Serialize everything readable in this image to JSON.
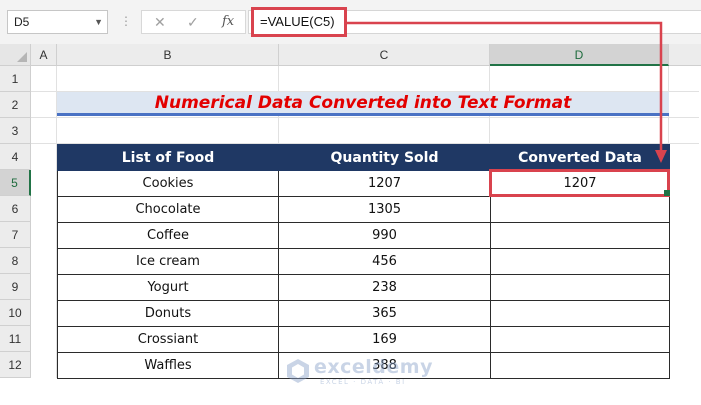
{
  "formula_bar": {
    "name_box": "D5",
    "formula": "=VALUE(C5)",
    "cancel_icon": "✕",
    "enter_icon": "✓",
    "fx_icon": "fx"
  },
  "columns": [
    "A",
    "B",
    "C",
    "D"
  ],
  "rows": [
    "1",
    "2",
    "3",
    "4",
    "5",
    "6",
    "7",
    "8",
    "9",
    "10",
    "11",
    "12"
  ],
  "active_cell": {
    "column": "D",
    "row": "5"
  },
  "title": "Numerical Data Converted into Text Format",
  "table": {
    "headers": [
      "List of Food",
      "Quantity Sold",
      "Converted Data"
    ],
    "rows": [
      [
        "Cookies",
        "1207",
        "1207"
      ],
      [
        "Chocolate",
        "1305",
        ""
      ],
      [
        "Coffee",
        "990",
        ""
      ],
      [
        "Ice cream",
        "456",
        ""
      ],
      [
        "Yogurt",
        "238",
        ""
      ],
      [
        "Donuts",
        "365",
        ""
      ],
      [
        "Crossiant",
        "169",
        ""
      ],
      [
        "Waffles",
        "388",
        ""
      ]
    ]
  },
  "watermark": {
    "name": "exceldemy",
    "tagline": "EXCEL · DATA · BI"
  },
  "colors": {
    "header_fill": "#1f3864",
    "title_fill": "#dde6f2",
    "title_text": "#e30000",
    "highlight": "#d9434e",
    "excel_green": "#217346"
  }
}
